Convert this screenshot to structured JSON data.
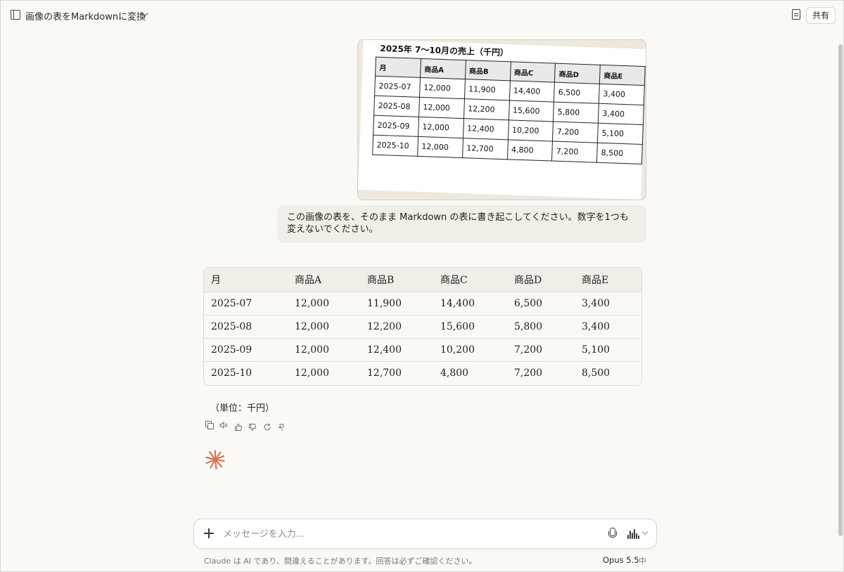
{
  "header": {
    "title": "画像の表をMarkdownに変換",
    "share_label": "共有"
  },
  "uploaded_image": {
    "caption": "2025年 7〜10月の売上（千円）",
    "rows": [
      [
        "月",
        "商品A",
        "商品B",
        "商品C",
        "商品D",
        "商品E"
      ],
      [
        "2025-07",
        "12,000",
        "11,900",
        "14,400",
        "6,500",
        "3,400"
      ],
      [
        "2025-08",
        "12,000",
        "12,200",
        "15,600",
        "5,800",
        "3,400"
      ],
      [
        "2025-09",
        "12,000",
        "12,400",
        "10,200",
        "7,200",
        "5,100"
      ],
      [
        "2025-10",
        "12,000",
        "12,700",
        "4,800",
        "7,200",
        "8,500"
      ]
    ]
  },
  "user_message": "この画像の表を、そのまま Markdown の表に書き起こしてください。数字を1つも変えないでください。",
  "response": {
    "headers": [
      "月",
      "商品A",
      "商品B",
      "商品C",
      "商品D",
      "商品E"
    ],
    "rows": [
      [
        "2025-07",
        "12,000",
        "11,900",
        "14,400",
        "6,500",
        "3,400"
      ],
      [
        "2025-08",
        "12,000",
        "12,200",
        "15,600",
        "5,800",
        "3,400"
      ],
      [
        "2025-09",
        "12,000",
        "12,400",
        "10,200",
        "7,200",
        "5,100"
      ],
      [
        "2025-10",
        "12,000",
        "12,700",
        "4,800",
        "7,200",
        "8,500"
      ]
    ],
    "unit_note": "（単位：千円）"
  },
  "action_icons": [
    "copy-icon",
    "speaker-icon",
    "thumbs-up-icon",
    "thumbs-down-icon",
    "retry-icon",
    "branch-icon"
  ],
  "composer": {
    "placeholder": "メッセージを入力...",
    "model": "Opus 5.5",
    "effort": "中"
  },
  "footer": {
    "disclaimer": "Claude は AI であり、間違えることがあります。回答は必ずご確認ください。"
  },
  "colors": {
    "background": "#faf9f5",
    "bubble": "#f0eee6",
    "accent": "#d97757"
  }
}
